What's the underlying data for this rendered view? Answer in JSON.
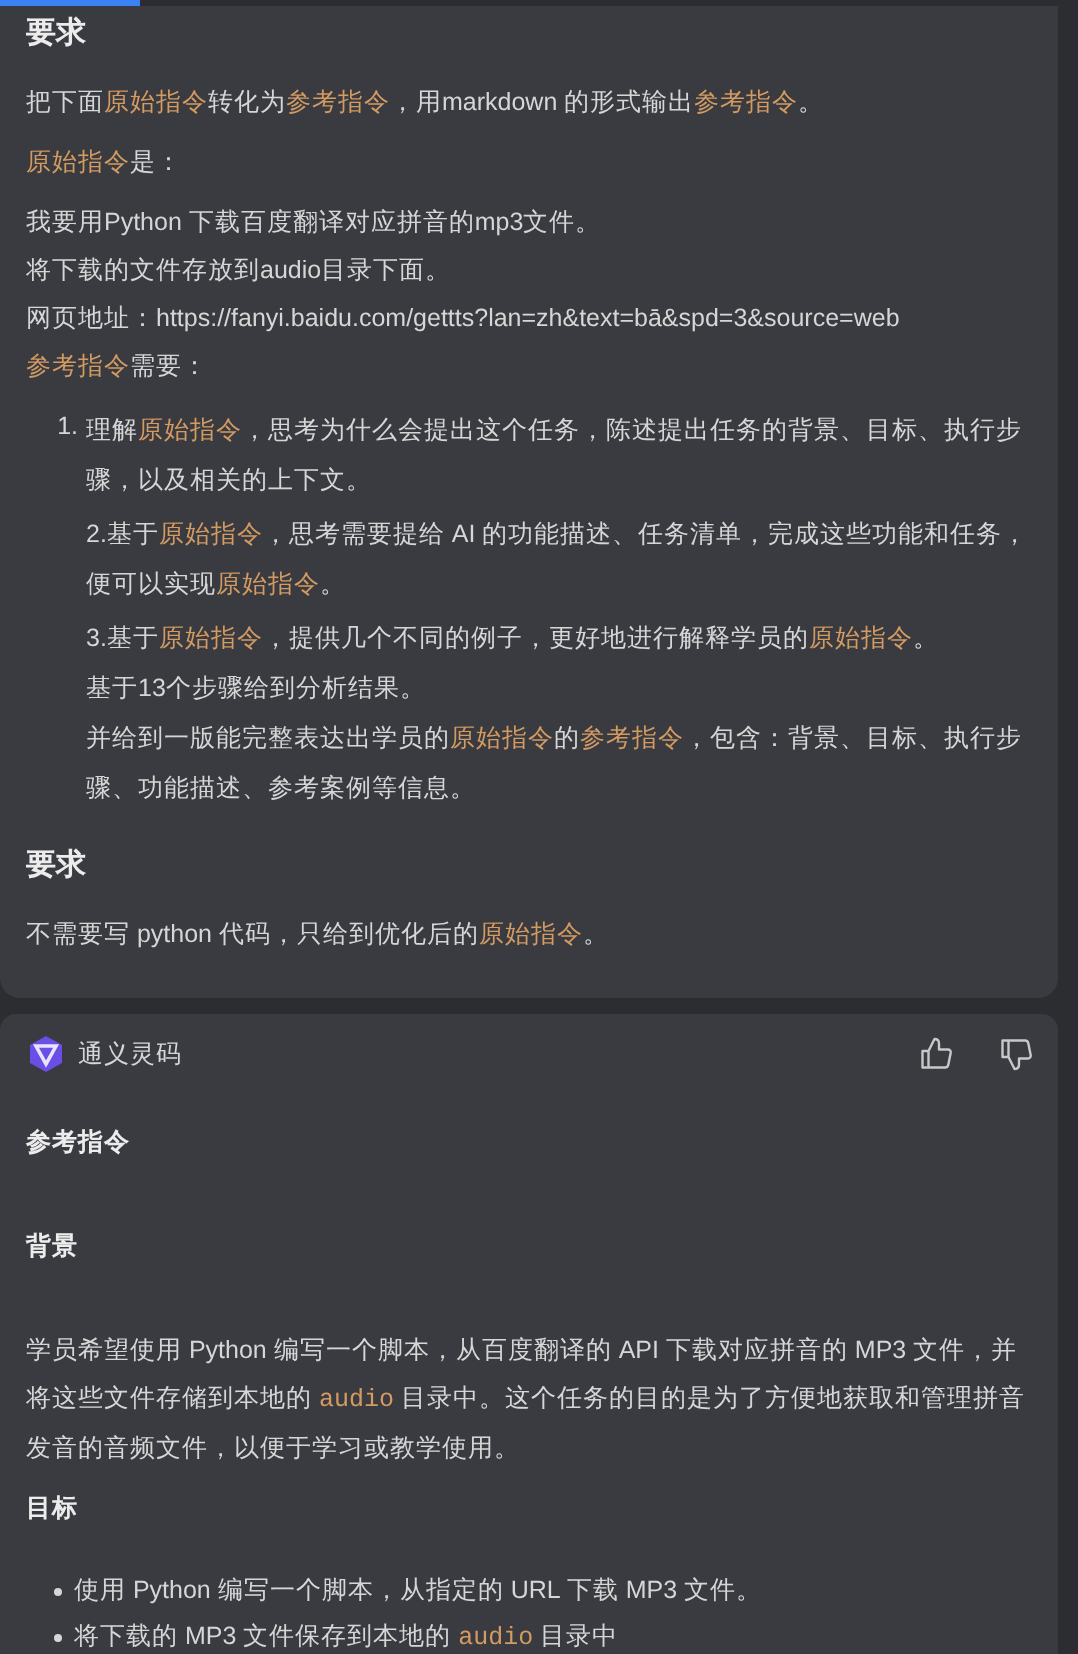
{
  "prompt_card": {
    "blocks": [
      {
        "kind": "heading",
        "segments": [
          {
            "kind": "plain",
            "text": "要求"
          }
        ]
      },
      {
        "kind": "para",
        "segments": [
          {
            "kind": "plain",
            "text": "把下面"
          },
          {
            "kind": "term",
            "text": "原始指令"
          },
          {
            "kind": "plain",
            "text": "转化为"
          },
          {
            "kind": "term",
            "text": "参考指令"
          },
          {
            "kind": "plain",
            "text": "，用markdown 的形式输出"
          },
          {
            "kind": "term",
            "text": "参考指令"
          },
          {
            "kind": "plain",
            "text": "。"
          }
        ]
      },
      {
        "kind": "para",
        "segments": [
          {
            "kind": "term",
            "text": "原始指令"
          },
          {
            "kind": "plain",
            "text": "是："
          }
        ]
      },
      {
        "kind": "line",
        "segments": [
          {
            "kind": "plain",
            "text": "我要用Python 下载百度翻译对应拼音的mp3文件。"
          }
        ]
      },
      {
        "kind": "line",
        "segments": [
          {
            "kind": "plain",
            "text": "将下载的文件存放到audio目录下面。"
          }
        ]
      },
      {
        "kind": "line",
        "segments": [
          {
            "kind": "plain",
            "text": "网页地址：https://fanyi.baidu.com/gettts?lan=zh&text=bā&spd=3&source=web"
          }
        ]
      },
      {
        "kind": "para",
        "segments": [
          {
            "kind": "term",
            "text": "参考指令"
          },
          {
            "kind": "plain",
            "text": "需要："
          }
        ]
      },
      {
        "kind": "ordered",
        "marker": "1.",
        "paragraphs": [
          [
            {
              "kind": "plain",
              "text": "理解"
            },
            {
              "kind": "term",
              "text": "原始指令"
            },
            {
              "kind": "plain",
              "text": "，思考为什么会提出这个任务，陈述提出任务的背景、目标、执行步骤，以及相关的上下文。"
            }
          ],
          [
            {
              "kind": "plain",
              "text": "2.基于"
            },
            {
              "kind": "term",
              "text": "原始指令"
            },
            {
              "kind": "plain",
              "text": "，思考需要提给 AI 的功能描述、任务清单，完成这些功能和任务，便可以实现"
            },
            {
              "kind": "term",
              "text": "原始指令"
            },
            {
              "kind": "plain",
              "text": "。"
            }
          ],
          [
            {
              "kind": "plain",
              "text": "3.基于"
            },
            {
              "kind": "term",
              "text": "原始指令"
            },
            {
              "kind": "plain",
              "text": "，提供几个不同的例子，更好地进行解释学员的"
            },
            {
              "kind": "term",
              "text": "原始指令"
            },
            {
              "kind": "plain",
              "text": "。"
            }
          ],
          [
            {
              "kind": "plain",
              "text": "基于13个步骤给到分析结果。"
            }
          ],
          [
            {
              "kind": "plain",
              "text": "并给到一版能完整表达出学员的"
            },
            {
              "kind": "term",
              "text": "原始指令"
            },
            {
              "kind": "plain",
              "text": "的"
            },
            {
              "kind": "term",
              "text": "参考指令"
            },
            {
              "kind": "plain",
              "text": "，包含：背景、目标、执行步骤、功能描述、参考案例等信息。"
            }
          ]
        ]
      },
      {
        "kind": "heading",
        "segments": [
          {
            "kind": "plain",
            "text": "要求"
          }
        ]
      },
      {
        "kind": "para",
        "segments": [
          {
            "kind": "plain",
            "text": "不需要写 python 代码，只给到优化后的"
          },
          {
            "kind": "term",
            "text": "原始指令"
          },
          {
            "kind": "plain",
            "text": "。"
          }
        ]
      }
    ]
  },
  "answer_card": {
    "author": "通义灵码",
    "blocks": [
      {
        "kind": "title",
        "segments": [
          {
            "kind": "plain",
            "text": "参考指令"
          }
        ]
      },
      {
        "kind": "title",
        "segments": [
          {
            "kind": "plain",
            "text": "背景"
          }
        ]
      },
      {
        "kind": "para",
        "segments": [
          {
            "kind": "plain",
            "text": "学员希望使用 Python 编写一个脚本，从百度翻译的 API 下载对应拼音的 MP3 文件，并将这些文件存储到本地的 "
          },
          {
            "kind": "code",
            "text": "audio"
          },
          {
            "kind": "plain",
            "text": " 目录中。这个任务的目的是为了方便地获取和管理拼音发音的音频文件，以便于学习或教学使用。"
          }
        ]
      },
      {
        "kind": "title",
        "segments": [
          {
            "kind": "plain",
            "text": "目标"
          }
        ]
      },
      {
        "kind": "bullets",
        "items": [
          [
            {
              "kind": "plain",
              "text": "使用 Python 编写一个脚本，从指定的 URL 下载 MP3 文件。"
            }
          ],
          [
            {
              "kind": "plain",
              "text": "将下载的 MP3 文件保存到本地的 "
            },
            {
              "kind": "code",
              "text": "audio"
            },
            {
              "kind": "plain",
              "text": " 目录中"
            }
          ]
        ]
      }
    ]
  }
}
